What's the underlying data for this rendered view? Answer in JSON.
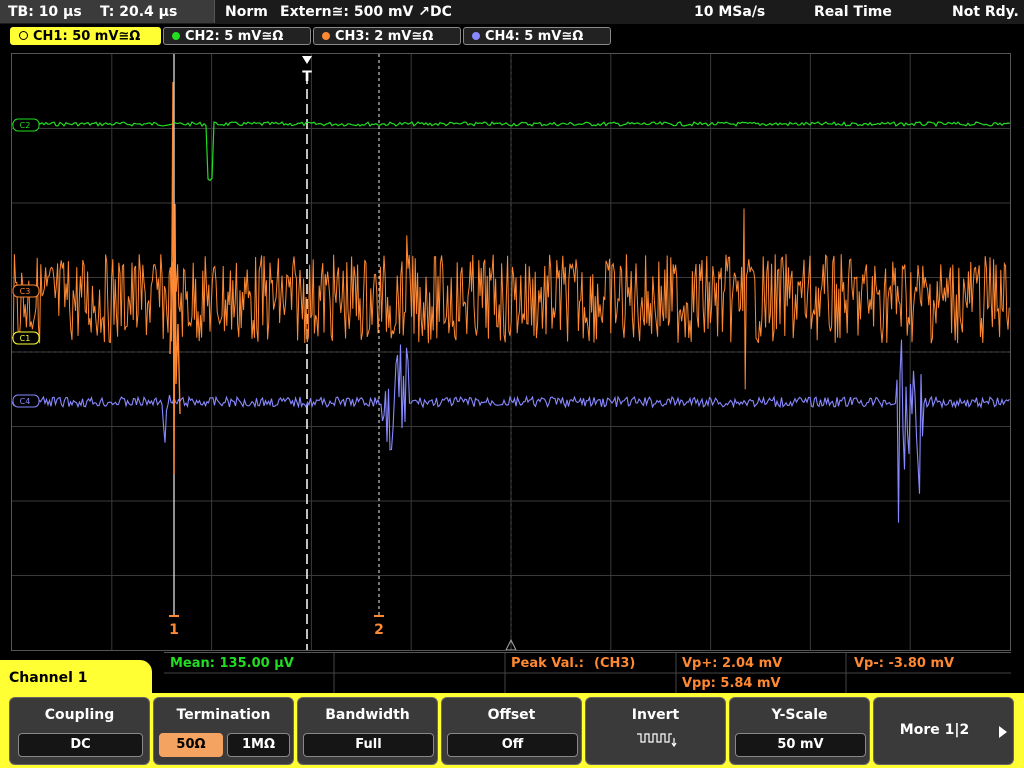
{
  "status": {
    "timebase": "TB: 10 µs",
    "trigger_time": "T: 20.4 µs",
    "trigger_mode": "Norm",
    "trigger_source": "Extern≅: 500 mV ↗DC",
    "sample_rate": "10 MSa/s",
    "acq_mode": "Real Time",
    "state": "Not Rdy."
  },
  "channels": [
    {
      "label": "CH1: 50 mV≅Ω",
      "color": "#ff8833",
      "active": true
    },
    {
      "label": "CH2: 5 mV≅Ω",
      "color": "#22dd22"
    },
    {
      "label": "CH3: 2 mV≅Ω",
      "color": "#ff8833"
    },
    {
      "label": "CH4: 5 mV≅Ω",
      "color": "#8888ff"
    }
  ],
  "markers": {
    "trigger": "T",
    "level_ch2": "C2",
    "level_ch3": "C3",
    "level_ch1": "C1",
    "level_ch4": "C4",
    "cursor1": "1",
    "cursor2": "2"
  },
  "measurements": {
    "mean": "Mean: 135.00 µV",
    "peak_label": "Peak Val.:",
    "peak_channel": "(CH3)",
    "vp_plus": "Vp+: 2.04 mV",
    "vp_minus": "Vp-: -3.80 mV",
    "vpp": "Vpp: 5.84 mV"
  },
  "menu": {
    "channel": "Channel 1",
    "coupling_title": "Coupling",
    "coupling_value": "DC",
    "termination_title": "Termination",
    "term_50": "50Ω",
    "term_1m": "1MΩ",
    "bandwidth_title": "Bandwidth",
    "bandwidth_value": "Full",
    "offset_title": "Offset",
    "offset_value": "Off",
    "invert_title": "Invert",
    "yscale_title": "Y-Scale",
    "yscale_value": "50 mV",
    "more": "More 1|2"
  },
  "colors": {
    "accent": "#ffff33",
    "ch_orange": "#ff8833",
    "ch_green": "#22dd22",
    "ch_blue": "#8888ff"
  }
}
